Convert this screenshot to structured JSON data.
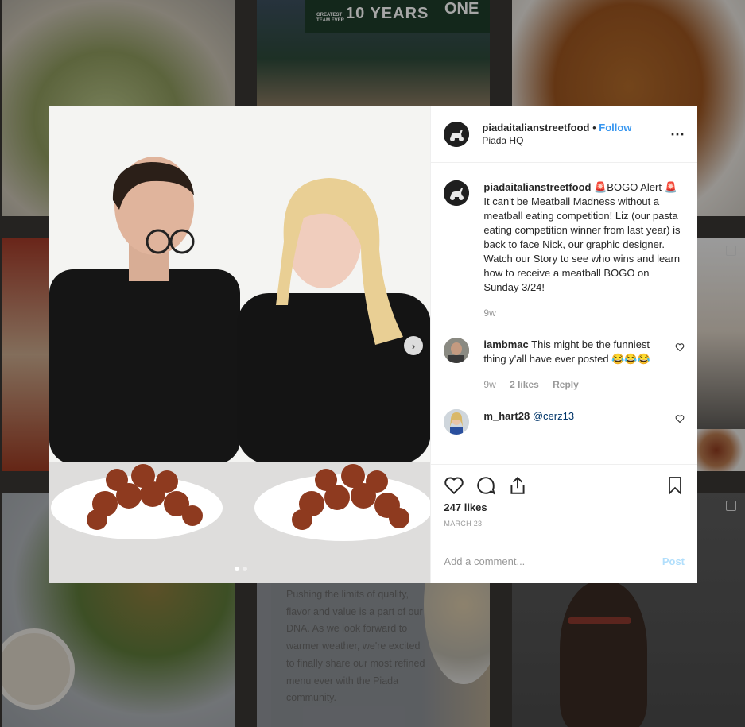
{
  "background": {
    "banner_text": "10 YEARS",
    "banner_text_right": "ONE",
    "banner_small": "GREATEST\nTEAM EVER",
    "card_text": "Pushing the limits of quality, flavor and value is a part of our DNA. As we look forward to warmer weather, we're excited to finally share our most refined menu ever with the Piada community."
  },
  "post": {
    "header": {
      "username": "piadaitalianstreetfood",
      "separator": "•",
      "follow_label": "Follow",
      "location": "Piada HQ"
    },
    "caption": {
      "username": "piadaitalianstreetfood",
      "text": "🚨BOGO Alert 🚨 It can't be Meatball Madness without a meatball eating competition! Liz (our pasta eating competition winner from last year) is back to face Nick, our graphic designer. Watch our Story to see who wins and learn how to receive a meatball BOGO on Sunday 3/24!",
      "age": "9w"
    },
    "comments": [
      {
        "username": "iambmac",
        "text": "This might be the funniest thing y'all have ever posted 😂😂😂",
        "age": "9w",
        "likes": "2 likes",
        "reply_label": "Reply"
      },
      {
        "username": "m_hart28",
        "text": "@cerz13"
      }
    ],
    "likes": "247 likes",
    "date": "MARCH 23",
    "add_comment_placeholder": "Add a comment...",
    "post_label": "Post",
    "more_icon": "⋯",
    "carousel": {
      "current": 1,
      "total": 2
    }
  },
  "colors": {
    "link": "#3897f0",
    "post_disabled": "#b2dffc",
    "muted": "#999999"
  }
}
